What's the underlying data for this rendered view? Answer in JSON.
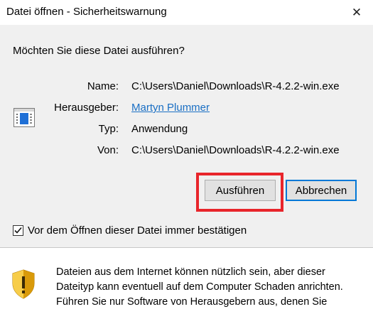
{
  "window": {
    "title": "Datei öffnen - Sicherheitswarnung",
    "close_glyph": "✕"
  },
  "prompt": {
    "question": "Möchten Sie diese Datei ausführen?"
  },
  "file_info": {
    "icon": "application-window-icon",
    "name_label": "Name:",
    "name_value": "C:\\Users\\Daniel\\Downloads\\R-4.2.2-win.exe",
    "publisher_label": "Herausgeber:",
    "publisher_value": "Martyn Plummer",
    "type_label": "Typ:",
    "type_value": "Anwendung",
    "from_label": "Von:",
    "from_value": "C:\\Users\\Daniel\\Downloads\\R-4.2.2-win.exe"
  },
  "buttons": {
    "run_label": "Ausführen",
    "cancel_label": "Abbrechen"
  },
  "checkbox": {
    "label": "Vor dem Öffnen dieser Datei immer bestätigen",
    "checked": true
  },
  "warning": {
    "icon": "security-shield-icon",
    "text_line1": "Dateien aus dem Internet können nützlich sein, aber dieser",
    "text_line2": "Dateityp kann eventuell auf dem Computer Schaden anrichten.",
    "text_line3": "Führen Sie nur Software von Herausgebern aus, denen Sie"
  },
  "colors": {
    "accent_border": "#0078d7",
    "highlight": "#e8252b",
    "link": "#1a6fc4",
    "panel": "#f0f0f0"
  }
}
